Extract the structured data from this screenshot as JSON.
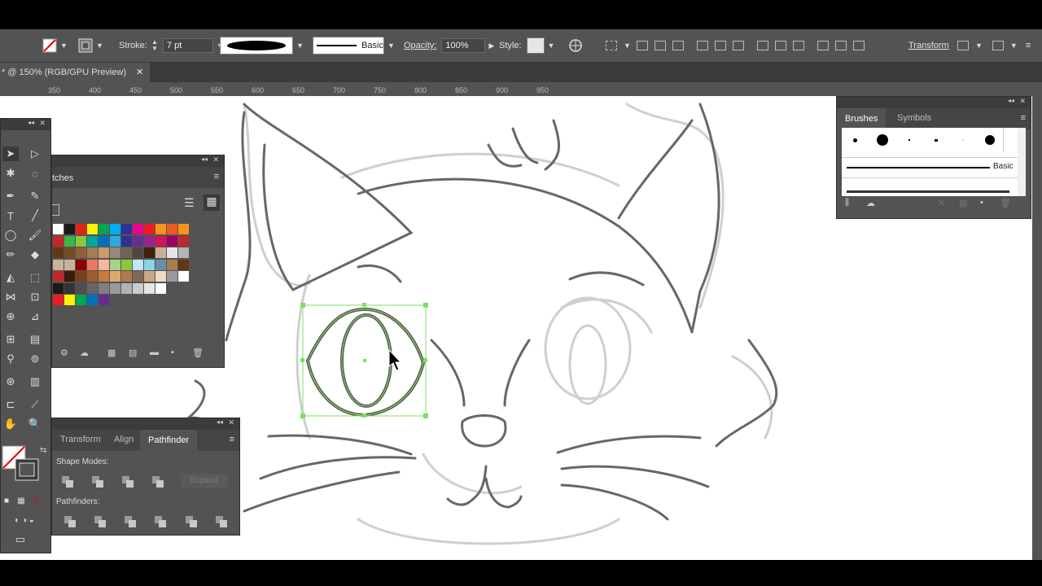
{
  "control_bar": {
    "stroke_label": "Stroke:",
    "stroke_weight": "7 pt",
    "brush_name": "Basic",
    "opacity_label": "Opacity:",
    "opacity_value": "100%",
    "style_label": "Style:",
    "transform_label": "Transform"
  },
  "document_tab": {
    "title": "* @ 150% (RGB/GPU Preview)",
    "close": "✕"
  },
  "ruler_ticks": [
    "350",
    "400",
    "450",
    "500",
    "550",
    "600",
    "650",
    "700",
    "750",
    "800",
    "850",
    "900",
    "950"
  ],
  "swatches_panel": {
    "title": "tches",
    "colors": [
      [
        "#ffffff",
        "#1a1a1a",
        "#e2231a",
        "#fff200",
        "#00a651",
        "#00aeef",
        "#2e3192",
        "#ec008c",
        "#ed1c24",
        "#f7941d",
        "#f15a24",
        "#f7941d"
      ],
      [
        "#c1272d",
        "#39b54a",
        "#8dc63f",
        "#00a99d",
        "#0071bc",
        "#29abe2",
        "#2e3192",
        "#662d91",
        "#93278f",
        "#d4145a",
        "#9e005d",
        "#c1272d"
      ],
      [
        "#603813",
        "#754c24",
        "#8c6239",
        "#a67c52",
        "#c69c6d",
        "#998675",
        "#736357",
        "#534741",
        "#42210b",
        "#c7b299",
        "#e6e6e6",
        "#b3b3b3"
      ],
      [
        "#c2b59b",
        "#c7b299",
        "#8b0000",
        "#e97a5b",
        "#f5b7a2",
        "#a9d18e",
        "#8dc63f",
        "#bfe6f3",
        "#8bd3e6",
        "#6b8da8",
        "#a97c50",
        "#603813"
      ],
      [
        "#c1272d",
        "#3c1a0a",
        "#7a3e1e",
        "#9e5b2f",
        "#c97a3e",
        "#e2a86b",
        "#b07a4e",
        "#7e6a57",
        "#c8a882",
        "#eddcc2",
        "#999999",
        "#ffffff"
      ],
      [
        "#1a1a1a",
        "#333333",
        "#4d4d4d",
        "#666666",
        "#808080",
        "#999999",
        "#b3b3b3",
        "#cccccc",
        "#e6e6e6",
        "#ffffff"
      ],
      [
        "#ed1c24",
        "#fff200",
        "#00a651",
        "#0071bc",
        "#662d91"
      ]
    ]
  },
  "pathfinder_panel": {
    "tabs": [
      "Transform",
      "Align",
      "Pathfinder"
    ],
    "shape_modes_label": "Shape Modes:",
    "expand_label": "Expand",
    "pathfinders_label": "Pathfinders:"
  },
  "brushes_panel": {
    "tabs": [
      "Brushes",
      "Symbols"
    ],
    "basic_label": "Basic"
  }
}
